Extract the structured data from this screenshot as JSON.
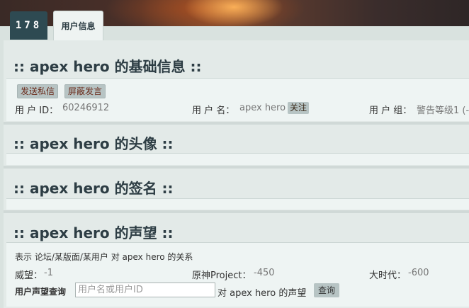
{
  "header": {
    "logo": "178",
    "tab_user_info": "用户信息"
  },
  "basic": {
    "title": ":: apex hero 的基础信息 ::",
    "send_pm": "发送私信",
    "block_posts": "屏蔽发言",
    "uid_label": "用 户 ID：",
    "uid_value": "60246912",
    "username_label": "用 户 名：",
    "username_value": "apex hero",
    "follow": "关注",
    "group_label": "用 户 组：",
    "group_value": "警告等级1 (-"
  },
  "avatar": {
    "title": ":: apex hero 的头像 ::"
  },
  "signature": {
    "title": ":: apex hero 的签名 ::"
  },
  "reputation": {
    "title": ":: apex hero 的声望 ::",
    "desc": "表示 论坛/某版面/某用户 对 apex hero 的关系",
    "items": [
      {
        "label": "威望：",
        "value": "-1"
      },
      {
        "label": "原神Project：",
        "value": "-450"
      },
      {
        "label": "大时代：",
        "value": "-600"
      }
    ],
    "query_label": "用户声望查询",
    "query_placeholder": "用户名或用户ID",
    "query_suffix": "对 apex hero 的声望",
    "query_button": "查询"
  }
}
